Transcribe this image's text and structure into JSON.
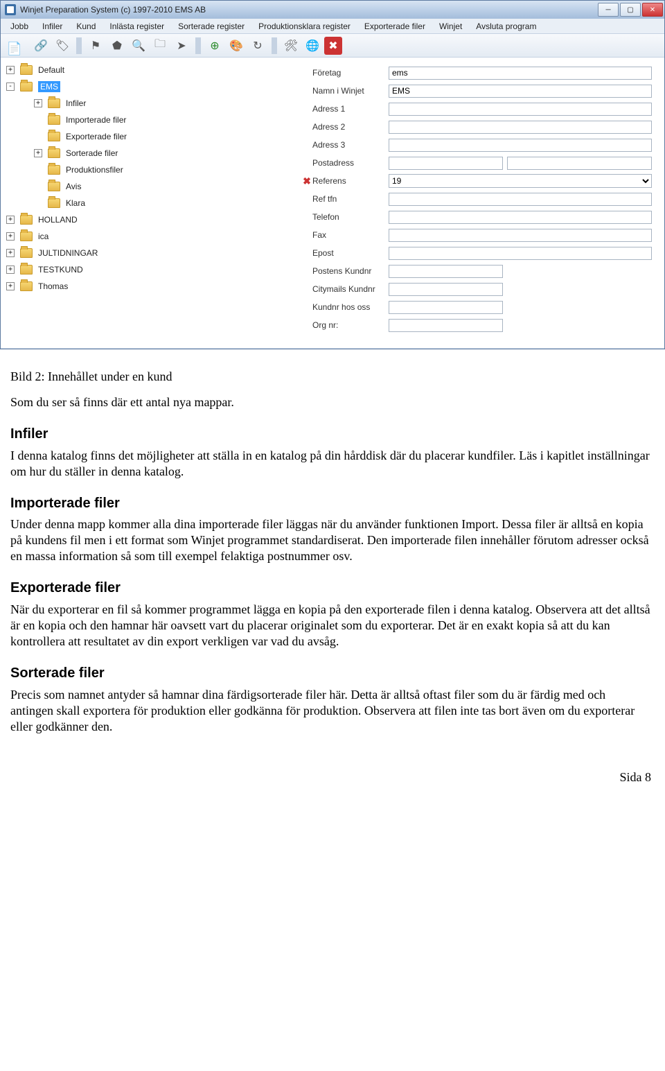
{
  "window": {
    "title": "Winjet Preparation System (c) 1997-2010 EMS AB"
  },
  "menubar": {
    "items": [
      "Jobb",
      "Infiler",
      "Kund",
      "Inlästa register",
      "Sorterade register",
      "Produktionsklara register",
      "Exporterade filer",
      "Winjet",
      "Avsluta program"
    ]
  },
  "tree": {
    "items": [
      {
        "level": 1,
        "exp": "+",
        "label": "Default"
      },
      {
        "level": 1,
        "exp": "-",
        "label": "EMS",
        "selected": true
      },
      {
        "level": 2,
        "exp": "+",
        "label": "Infiler"
      },
      {
        "level": 2,
        "exp": "",
        "label": "Importerade filer"
      },
      {
        "level": 2,
        "exp": "",
        "label": "Exporterade filer"
      },
      {
        "level": 2,
        "exp": "+",
        "label": "Sorterade filer"
      },
      {
        "level": 2,
        "exp": "",
        "label": "Produktionsfiler"
      },
      {
        "level": 2,
        "exp": "",
        "label": "Avis"
      },
      {
        "level": 2,
        "exp": "",
        "label": "Klara"
      },
      {
        "level": 1,
        "exp": "+",
        "label": "HOLLAND"
      },
      {
        "level": 1,
        "exp": "+",
        "label": "ica"
      },
      {
        "level": 1,
        "exp": "+",
        "label": "JULTIDNINGAR"
      },
      {
        "level": 1,
        "exp": "+",
        "label": "TESTKUND"
      },
      {
        "level": 1,
        "exp": "+",
        "label": "Thomas"
      }
    ]
  },
  "form": {
    "rows": [
      {
        "label": "Företag",
        "value": "ems"
      },
      {
        "label": "Namn i Winjet",
        "value": "EMS"
      },
      {
        "label": "Adress 1",
        "value": ""
      },
      {
        "label": "Adress 2",
        "value": ""
      },
      {
        "label": "Adress 3",
        "value": ""
      },
      {
        "label": "Postadress",
        "value": "",
        "type": "postal"
      },
      {
        "label": "Referens",
        "value": "19",
        "type": "select",
        "x": true
      },
      {
        "label": "Ref tfn",
        "value": ""
      },
      {
        "label": "Telefon",
        "value": ""
      },
      {
        "label": "Fax",
        "value": ""
      },
      {
        "label": "Epost",
        "value": ""
      },
      {
        "label": "Postens Kundnr",
        "value": "",
        "type": "short"
      },
      {
        "label": "Citymails Kundnr",
        "value": "",
        "type": "short"
      },
      {
        "label": "Kundnr hos oss",
        "value": "",
        "type": "short"
      },
      {
        "label": "Org nr:",
        "value": "",
        "type": "short"
      }
    ]
  },
  "article": {
    "caption": "Bild 2: Innehållet under en kund",
    "intro": "Som du ser så finns där ett antal nya mappar.",
    "sections": [
      {
        "heading": "Infiler",
        "body": "I denna katalog finns det möjligheter att ställa in en katalog på din hårddisk där du placerar kundfiler. Läs i kapitlet inställningar om hur du ställer in denna katalog."
      },
      {
        "heading": "Importerade filer",
        "body": "Under denna mapp kommer alla dina importerade filer läggas när du använder funktionen Import. Dessa filer är alltså en kopia på kundens fil men i ett format som Winjet programmet standardiserat. Den importerade filen innehåller förutom adresser också en massa information så som till exempel felaktiga postnummer osv."
      },
      {
        "heading": "Exporterade filer",
        "body": "När du exporterar en fil så kommer programmet lägga en kopia på den exporterade filen i denna katalog. Observera att det alltså är en kopia och den hamnar här oavsett vart du placerar originalet som du exporterar. Det är en exakt kopia så att du kan kontrollera att resultatet av din export verkligen var vad du avsåg."
      },
      {
        "heading": "Sorterade filer",
        "body": "Precis som namnet antyder så hamnar dina färdigsorterade filer här. Detta är alltså oftast filer som du är färdig med och antingen skall exportera för produktion eller godkänna för produktion. Observera att filen inte tas bort även om du exporterar eller godkänner den."
      }
    ],
    "page": "Sida 8"
  }
}
